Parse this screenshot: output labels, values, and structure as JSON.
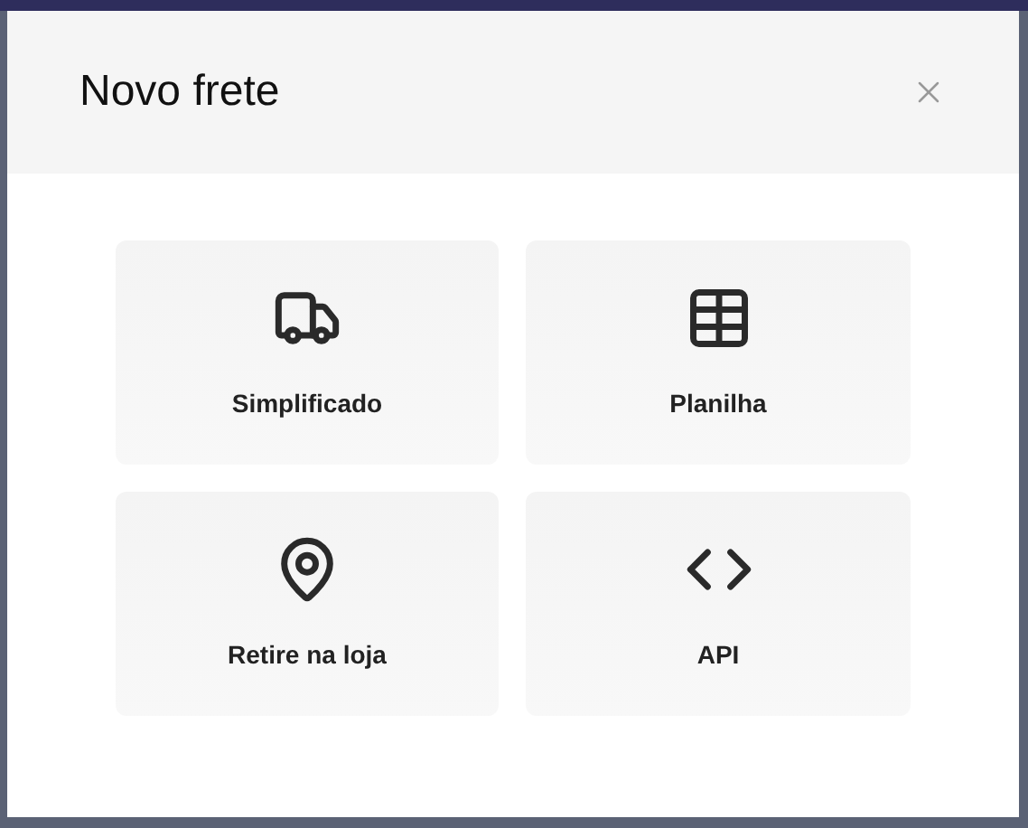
{
  "dialog": {
    "title": "Novo frete",
    "options": [
      {
        "kind": "truck",
        "label": "Simplificado"
      },
      {
        "kind": "table",
        "label": "Planilha"
      },
      {
        "kind": "pin",
        "label": "Retire na loja"
      },
      {
        "kind": "code",
        "label": "API"
      }
    ]
  }
}
